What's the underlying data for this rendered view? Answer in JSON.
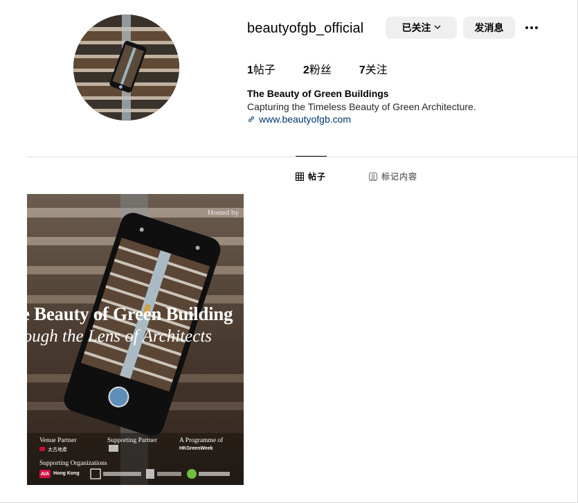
{
  "profile": {
    "username": "beautyofgb_official",
    "follow_button": "已关注",
    "message_button": "发消息",
    "more_icon": "more-horizontal-icon",
    "stats": {
      "posts_count": "1",
      "posts_label": "帖子",
      "followers_count": "2",
      "followers_label": "粉丝",
      "following_count": "7",
      "following_label": "关注"
    },
    "bio_name": "The Beauty of Green Buildings",
    "bio_text": "Capturing the Timeless Beauty of Green Architecture.",
    "bio_link": "www.beautyofgb.com"
  },
  "tabs": [
    {
      "label": "帖子",
      "icon": "grid-icon",
      "active": true
    },
    {
      "label": "标记内容",
      "icon": "tagged-user-icon",
      "active": false
    }
  ],
  "post": {
    "hosted_by": "Hosted by",
    "title_line1": "e Beauty of Green Building",
    "title_line2": "rough the Lens of Architects",
    "venue_partner": "Venue Partner",
    "supporting_partner": "Supporting Partner",
    "programme_of": "A Programme of",
    "supporting_orgs": "Supporting Organizations",
    "venue_logo": "太古地產",
    "hkgw_logo": "HKGreenWeek",
    "aia_logo": "AIA",
    "hk_logo": "Hong Kong"
  },
  "colors": {
    "button_bg": "#efefef",
    "link": "#00376b",
    "muted": "#737373"
  }
}
